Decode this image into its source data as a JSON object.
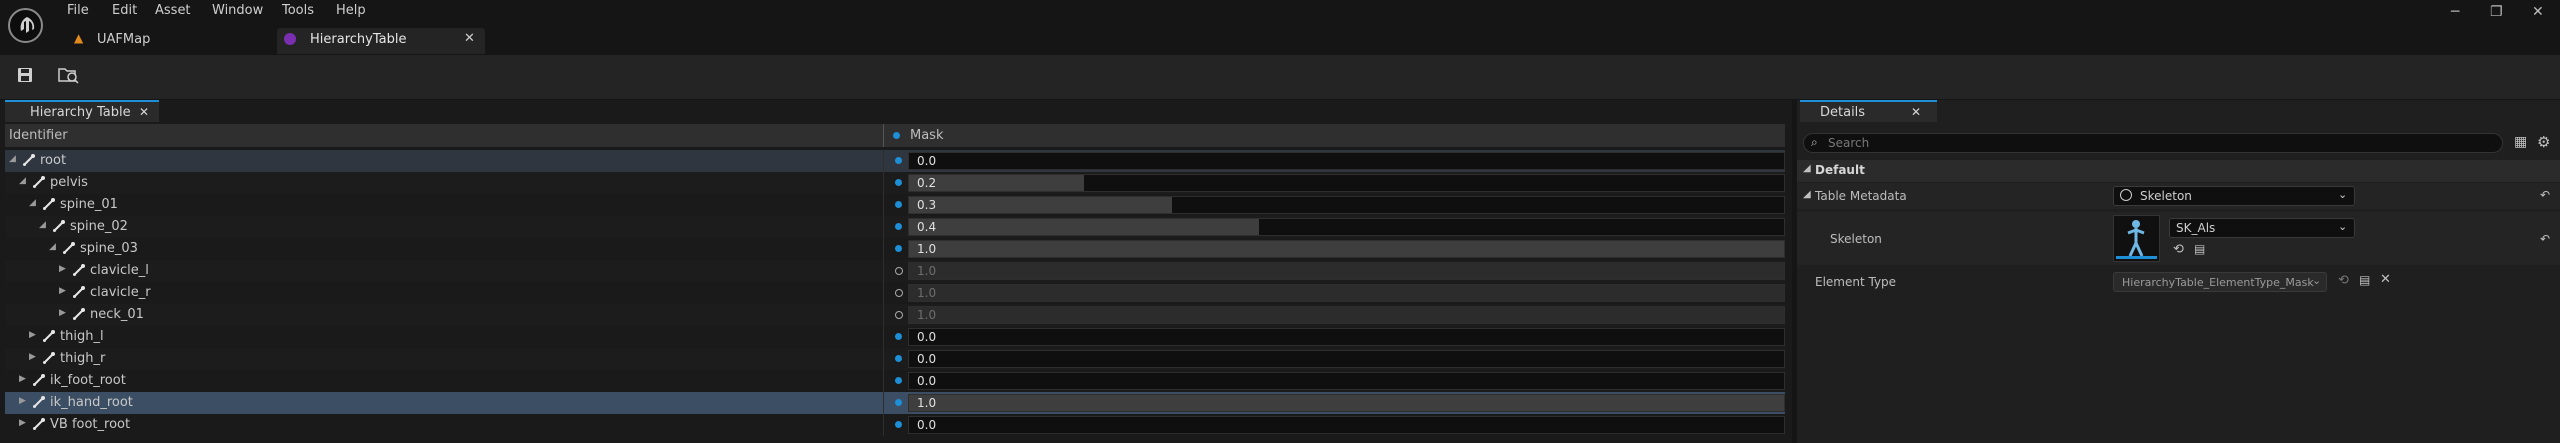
{
  "menu": [
    "File",
    "Edit",
    "Asset",
    "Window",
    "Tools",
    "Help"
  ],
  "tabs": {
    "map": "UAFMap",
    "table": "HierarchyTable"
  },
  "hierarchy": {
    "tab": "Hierarchy Table",
    "col_identifier": "Identifier",
    "col_mask": "Mask",
    "rows": [
      {
        "label": "root",
        "value": "0.0",
        "fill": 0.0,
        "dim": false
      },
      {
        "label": "pelvis",
        "value": "0.2",
        "fill": 0.2,
        "dim": false
      },
      {
        "label": "spine_01",
        "value": "0.3",
        "fill": 0.3,
        "dim": false
      },
      {
        "label": "spine_02",
        "value": "0.4",
        "fill": 0.4,
        "dim": false
      },
      {
        "label": "spine_03",
        "value": "1.0",
        "fill": 1.0,
        "dim": false
      },
      {
        "label": "clavicle_l",
        "value": "1.0",
        "fill": 1.0,
        "dim": true
      },
      {
        "label": "clavicle_r",
        "value": "1.0",
        "fill": 1.0,
        "dim": true
      },
      {
        "label": "neck_01",
        "value": "1.0",
        "fill": 1.0,
        "dim": true
      },
      {
        "label": "thigh_l",
        "value": "0.0",
        "fill": 0.0,
        "dim": false
      },
      {
        "label": "thigh_r",
        "value": "0.0",
        "fill": 0.0,
        "dim": false
      },
      {
        "label": "ik_foot_root",
        "value": "0.0",
        "fill": 0.0,
        "dim": false
      },
      {
        "label": "ik_hand_root",
        "value": "1.0",
        "fill": 1.0,
        "dim": false
      },
      {
        "label": "VB foot_root",
        "value": "0.0",
        "fill": 0.0,
        "dim": false
      }
    ]
  },
  "details": {
    "tab": "Details",
    "search_placeholder": "Search",
    "section": "Default",
    "table_metadata_label": "Table Metadata",
    "table_metadata_value": "Skeleton",
    "skeleton_label": "Skeleton",
    "skeleton_value": "SK_Als",
    "element_type_label": "Element Type",
    "element_type_value": "HierarchyTable_ElementType_Mask"
  },
  "colors": {
    "accent": "#1e8fd6",
    "selected_row": "#3b4e63"
  }
}
